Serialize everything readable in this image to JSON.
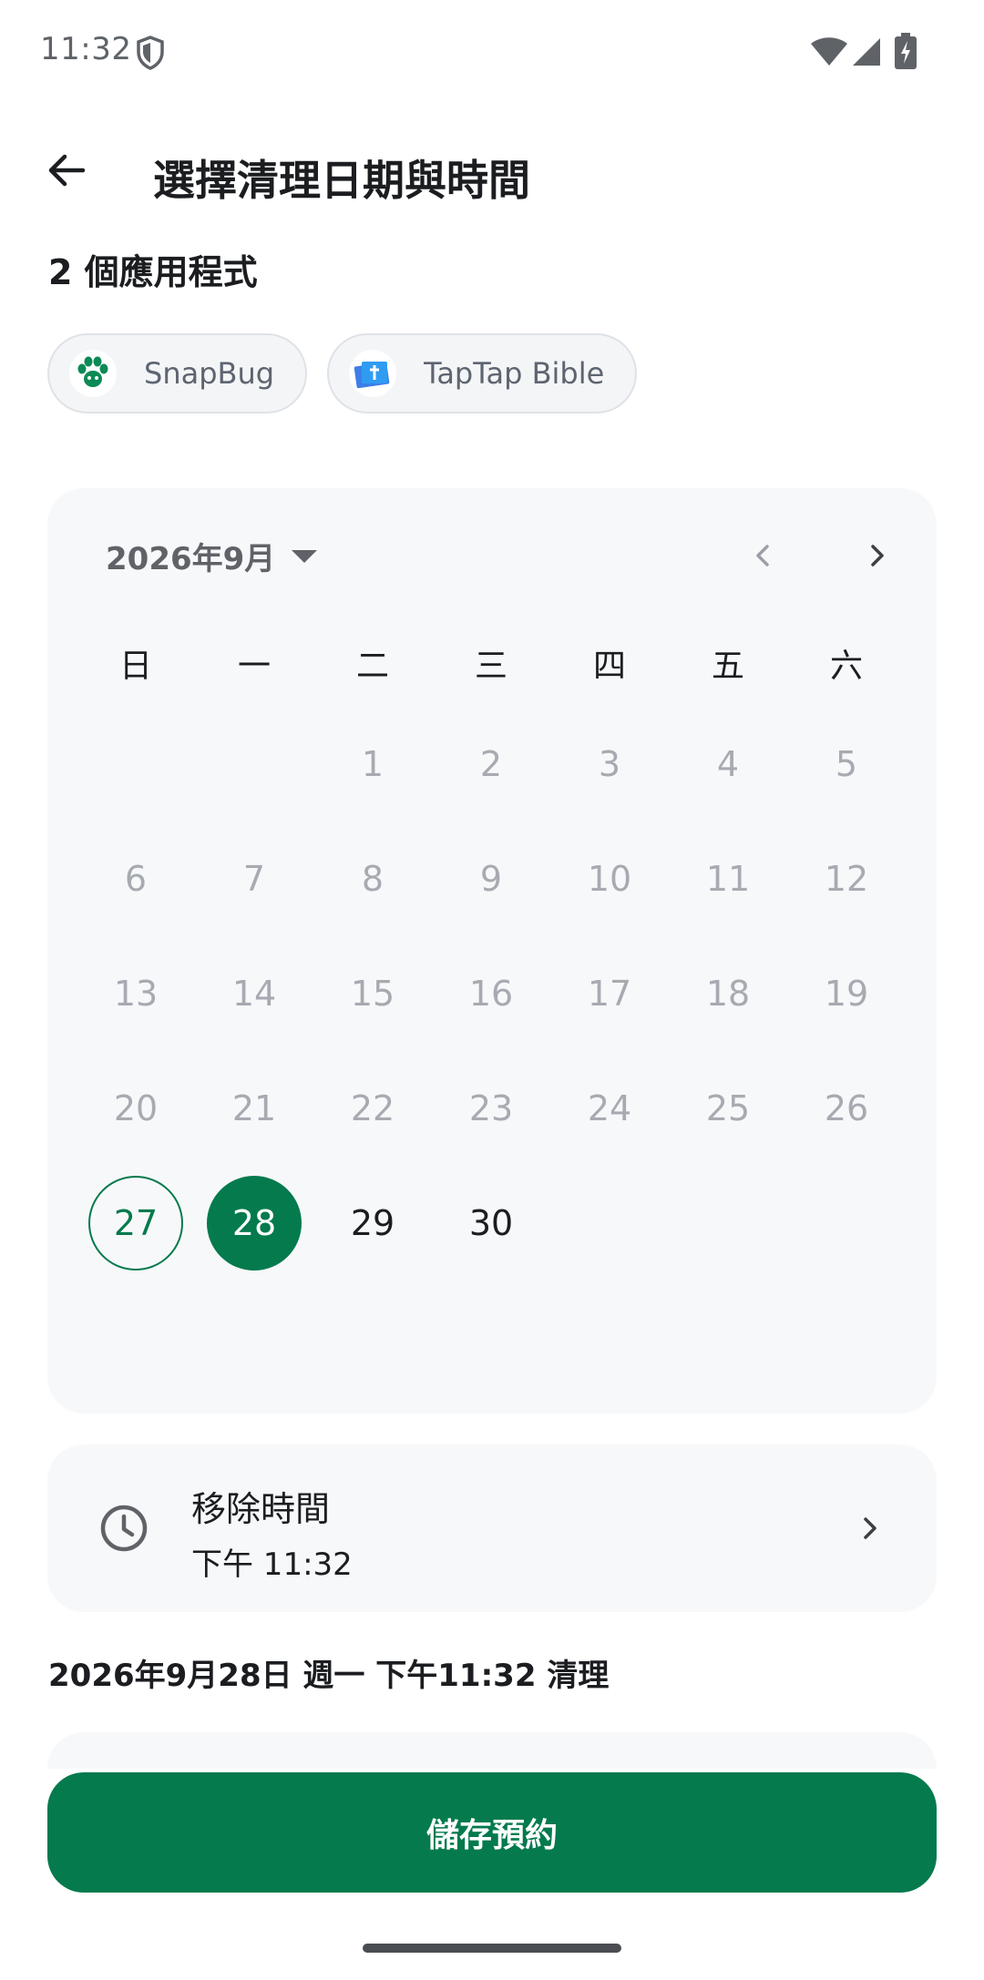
{
  "status_bar": {
    "time": "11:32",
    "icons": [
      "shield-icon",
      "wifi-icon",
      "signal-icon",
      "battery-charging-icon"
    ]
  },
  "header": {
    "title": "選擇清理日期與時間",
    "back_icon": "arrow-back-icon"
  },
  "apps": {
    "count_label": "2 個應用程式",
    "items": [
      {
        "name": "SnapBug",
        "icon": "paw-icon"
      },
      {
        "name": "TapTap Bible",
        "icon": "bible-book-icon"
      }
    ]
  },
  "calendar": {
    "month_label": "2026年9月",
    "weekdays": [
      "日",
      "一",
      "二",
      "三",
      "四",
      "五",
      "六"
    ],
    "leading_blanks": 2,
    "days": [
      {
        "n": "1",
        "state": "disabled"
      },
      {
        "n": "2",
        "state": "disabled"
      },
      {
        "n": "3",
        "state": "disabled"
      },
      {
        "n": "4",
        "state": "disabled"
      },
      {
        "n": "5",
        "state": "disabled"
      },
      {
        "n": "6",
        "state": "disabled"
      },
      {
        "n": "7",
        "state": "disabled"
      },
      {
        "n": "8",
        "state": "disabled"
      },
      {
        "n": "9",
        "state": "disabled"
      },
      {
        "n": "10",
        "state": "disabled"
      },
      {
        "n": "11",
        "state": "disabled"
      },
      {
        "n": "12",
        "state": "disabled"
      },
      {
        "n": "13",
        "state": "disabled"
      },
      {
        "n": "14",
        "state": "disabled"
      },
      {
        "n": "15",
        "state": "disabled"
      },
      {
        "n": "16",
        "state": "disabled"
      },
      {
        "n": "17",
        "state": "disabled"
      },
      {
        "n": "18",
        "state": "disabled"
      },
      {
        "n": "19",
        "state": "disabled"
      },
      {
        "n": "20",
        "state": "disabled"
      },
      {
        "n": "21",
        "state": "disabled"
      },
      {
        "n": "22",
        "state": "disabled"
      },
      {
        "n": "23",
        "state": "disabled"
      },
      {
        "n": "24",
        "state": "disabled"
      },
      {
        "n": "25",
        "state": "disabled"
      },
      {
        "n": "26",
        "state": "disabled"
      },
      {
        "n": "27",
        "state": "today"
      },
      {
        "n": "28",
        "state": "selected"
      },
      {
        "n": "29",
        "state": "enabled"
      },
      {
        "n": "30",
        "state": "enabled"
      }
    ]
  },
  "removal_time": {
    "title": "移除時間",
    "value": "下午 11:32"
  },
  "summary": "2026年9月28日 週一 下午11:32 清理",
  "save_button": "儲存預約",
  "colors": {
    "accent": "#047a4d",
    "surface": "#f7f8fa",
    "disabled_text": "#a7abb1"
  }
}
